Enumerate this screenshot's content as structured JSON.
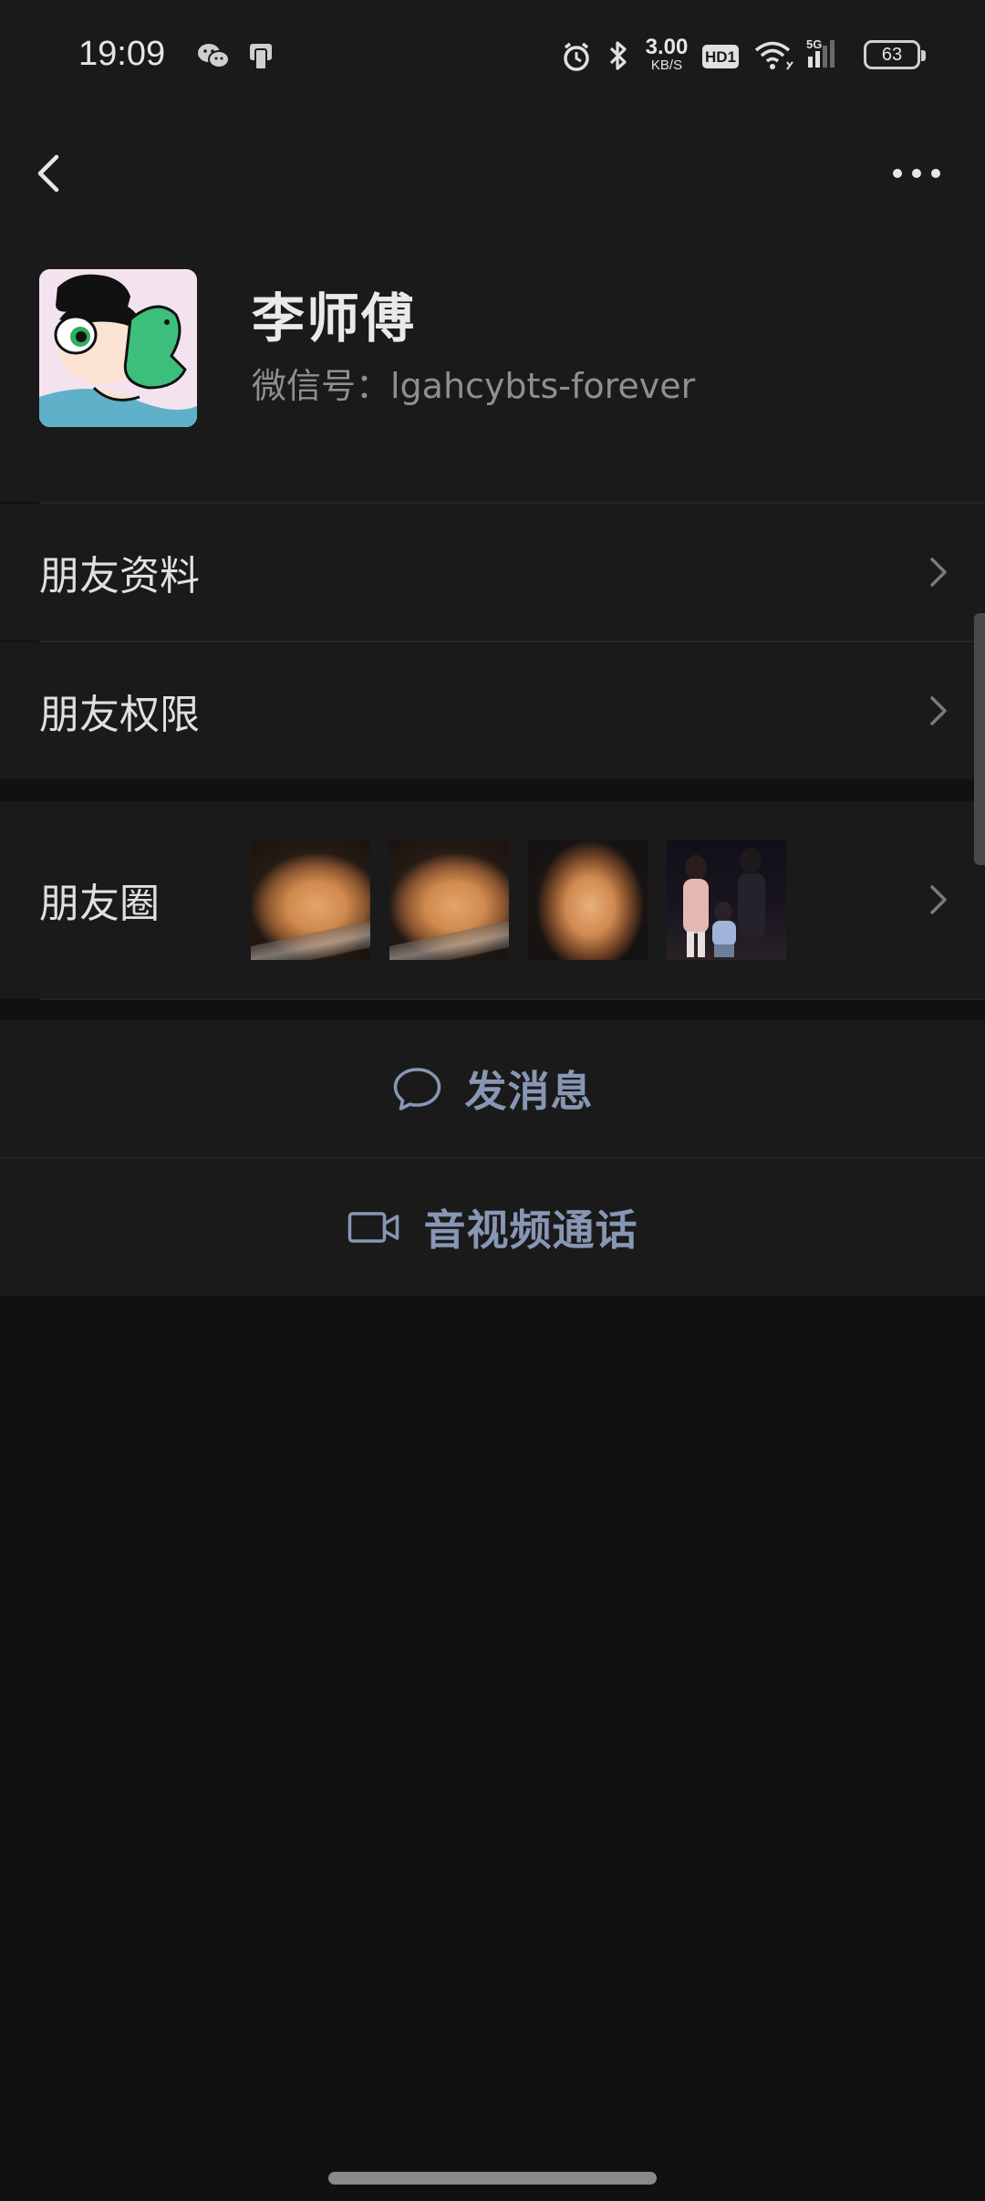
{
  "status_bar": {
    "time": "19:09",
    "net_speed_value": "3.00",
    "net_speed_unit": "KB/S",
    "hd_badge": "HD1",
    "network_type": "5G",
    "battery": "63",
    "icons": [
      "wechat-icon",
      "notification-phone-icon",
      "alarm-icon",
      "bluetooth-icon",
      "wifi-icon",
      "signal-icon",
      "battery-icon"
    ]
  },
  "nav": {
    "back_icon": "chevron-left-icon",
    "more_icon": "more-dots-icon"
  },
  "profile": {
    "name": "李师傅",
    "wechat_id": "微信号：lgahcybts-forever"
  },
  "menu": {
    "friend_profile": "朋友资料",
    "friend_permissions": "朋友权限"
  },
  "moments": {
    "label": "朋友圈",
    "thumbnail_count": 4
  },
  "actions": {
    "send_message": "发消息",
    "av_call": "音视频通话"
  }
}
